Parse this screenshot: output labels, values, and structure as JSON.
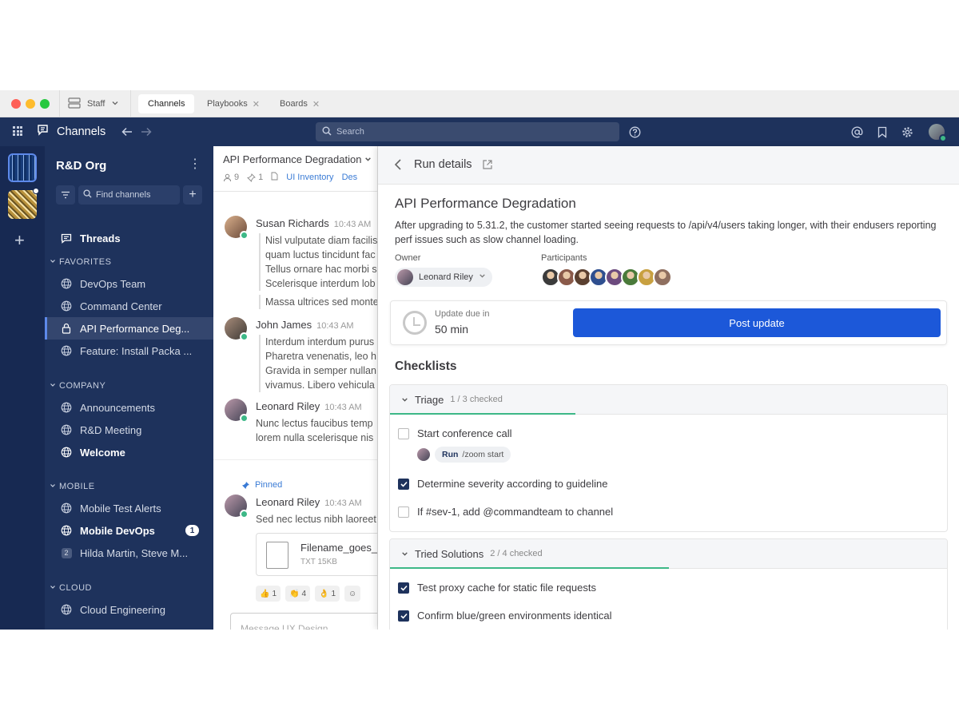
{
  "titlebar": {
    "team_switch": "Staff",
    "tabs": [
      {
        "label": "Channels",
        "active": true
      },
      {
        "label": "Playbooks",
        "closable": true
      },
      {
        "label": "Boards",
        "closable": true
      }
    ]
  },
  "header": {
    "product": "Channels",
    "search_placeholder": "Search"
  },
  "sidebar": {
    "org": "R&D Org",
    "find_placeholder": "Find channels",
    "threads": "Threads",
    "categories": {
      "favorites": "FAVORITES",
      "company": "COMPANY",
      "mobile": "MOBILE",
      "cloud": "CLOUD"
    },
    "favorites": [
      "DevOps Team",
      "Command Center",
      "API Performance Deg...",
      "Feature: Install Packa ..."
    ],
    "company": [
      "Announcements",
      "R&D Meeting",
      "Welcome"
    ],
    "mobile": [
      "Mobile Test Alerts",
      "Mobile DevOps",
      "Hilda Martin, Steve M..."
    ],
    "cloud": [
      "Cloud Engineering"
    ],
    "mobile_devops_unread": "1",
    "dm_count": "2"
  },
  "channel": {
    "title": "API Performance Degradation",
    "member_count": "9",
    "pinned_count": "1",
    "bookmark": "UI Inventory",
    "bookmark2": "Des",
    "posts": [
      {
        "name": "Susan Richards",
        "time": "10:43 AM",
        "lines": [
          "Nisl vulputate diam facilis",
          "quam luctus tincidunt fac",
          "Tellus ornare hac morbi s",
          "Scelerisque interdum lob"
        ],
        "extra": "Massa ultrices sed monte"
      },
      {
        "name": "John James",
        "time": "10:43 AM",
        "lines": [
          "Interdum interdum purus",
          "Pharetra venenatis, leo h",
          "Gravida in semper nullan",
          "vivamus. Libero vehicula"
        ]
      },
      {
        "name": "Leonard Riley",
        "time": "10:43 AM",
        "lines": [
          "Nunc lectus faucibus temp",
          "lorem nulla scelerisque nis"
        ]
      },
      {
        "name": "Leonard Riley",
        "time": "10:43 AM",
        "lines": [
          "Sed nec lectus nibh laoreet"
        ]
      }
    ],
    "pinned_label": "Pinned",
    "file": {
      "name": "Filename_goes_h",
      "meta": "TXT 15KB"
    },
    "reactions": [
      {
        "emoji": "👍",
        "count": "1"
      },
      {
        "emoji": "👏",
        "count": "4"
      },
      {
        "emoji": "👌",
        "count": "1"
      }
    ],
    "message_placeholder": "Message UX Design"
  },
  "rhs": {
    "title": "Run details",
    "run_name": "API Performance Degradation",
    "description": "After upgrading to 5.31.2, the customer started seeing requests to /api/v4/users taking longer, with their endusers reporting perf issues such as slow channel loading.",
    "owner_label": "Owner",
    "owner": "Leonard Riley",
    "participants_label": "Participants",
    "participant_colors": [
      "#3b3b3b",
      "#8a5a4a",
      "#5b4030",
      "#2f4f8f",
      "#6c4a7e",
      "#4a7a3a",
      "#c8a040",
      "#8f6f5f"
    ],
    "update_due_label": "Update due in",
    "update_due_value": "50 min",
    "post_update": "Post update",
    "checklists_title": "Checklists",
    "checklists": [
      {
        "name": "Triage",
        "progress": "1 / 3 checked",
        "fraction": 0.3333,
        "items": [
          {
            "text": "Start conference call",
            "checked": false,
            "command": {
              "run": "Run",
              "cmd": "/zoom start"
            }
          },
          {
            "text": "Determine severity according to guideline",
            "checked": true
          },
          {
            "text": "If #sev-1, add @commandteam to channel",
            "checked": false
          }
        ]
      },
      {
        "name": "Tried Solutions",
        "progress": "2 / 4 checked",
        "fraction": 0.5,
        "items": [
          {
            "text": "Test proxy cache for static file requests",
            "checked": true
          },
          {
            "text": "Confirm blue/green environments identical",
            "checked": true
          }
        ]
      }
    ]
  },
  "colors": {
    "sidebar": "#1e325c",
    "header": "#1e325c",
    "accent": "#1c58d9",
    "online": "#3db887"
  }
}
